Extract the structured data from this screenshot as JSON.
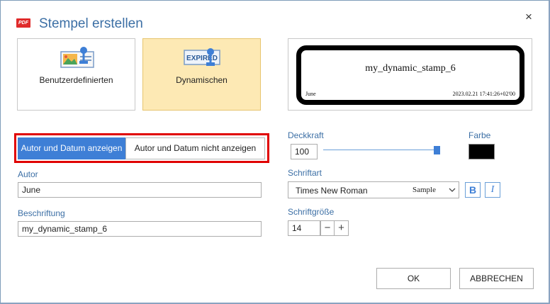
{
  "dialog": {
    "title": "Stempel erstellen",
    "app_icon_label": "PDF",
    "close_label": "×"
  },
  "stamp_types": [
    {
      "label": "Benutzerdefinierten",
      "icon": "custom-stamp-icon",
      "selected": false
    },
    {
      "label": "Dynamischen",
      "icon": "dynamic-stamp-icon",
      "icon_text": "EXPIRED",
      "selected": true
    }
  ],
  "preview": {
    "name": "my_dynamic_stamp_6",
    "author": "June",
    "date": "2023.02.21 17:41:26+02'00"
  },
  "toggle": {
    "show_label": "Autor und Datum anzeigen",
    "hide_label": "Autor und Datum nicht anzeigen",
    "active": "show"
  },
  "fields": {
    "author_label": "Autor",
    "author_value": "June",
    "caption_label": "Beschriftung",
    "caption_value": "my_dynamic_stamp_6"
  },
  "opacity": {
    "label": "Deckkraft",
    "value": "100",
    "level_percent": 100
  },
  "color": {
    "label": "Farbe",
    "value": "#000000"
  },
  "font": {
    "label": "Schriftart",
    "name": "Times New Roman",
    "sample": "Sample",
    "bold_label": "B",
    "italic_label": "I"
  },
  "font_size": {
    "label": "Schriftgröße",
    "value": "14",
    "minus": "−",
    "plus": "+"
  },
  "buttons": {
    "ok": "OK",
    "cancel": "ABBRECHEN"
  },
  "colors": {
    "accent": "#3e7fd6",
    "title": "#3c6fa5",
    "selected_card": "#fde9b4",
    "highlight_outline": "#e00000"
  }
}
